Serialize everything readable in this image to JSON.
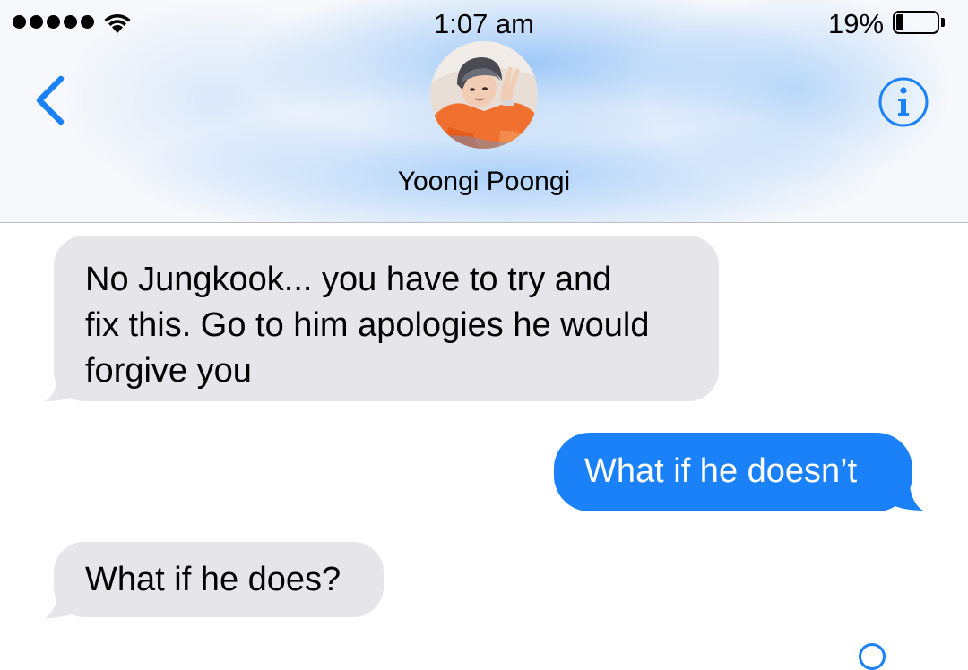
{
  "status_bar": {
    "time": "1:07 am",
    "battery_percent": "19%",
    "battery_level": 0.19,
    "signal_bars": 5,
    "icons": [
      "signal-dots-icon",
      "wifi-icon",
      "battery-icon"
    ]
  },
  "header": {
    "contact_name": "Yoongi Poongi",
    "back_icon": "chevron-left-icon",
    "info_icon": "info-icon",
    "avatar": "contact-avatar-photo"
  },
  "messages": [
    {
      "direction": "received",
      "text": "No Jungkook... you have to try and\nfix this. Go to him apologies he would\nforgive you"
    },
    {
      "direction": "sent",
      "text": "What if he doesn’t"
    },
    {
      "direction": "received",
      "text": "What if he does?"
    }
  ],
  "colors": {
    "accent": "#1a81f8",
    "received_bubble": "#e5e5ea",
    "sent_bubble": "#1a81f8",
    "header_tint": "#a8cdf9"
  }
}
